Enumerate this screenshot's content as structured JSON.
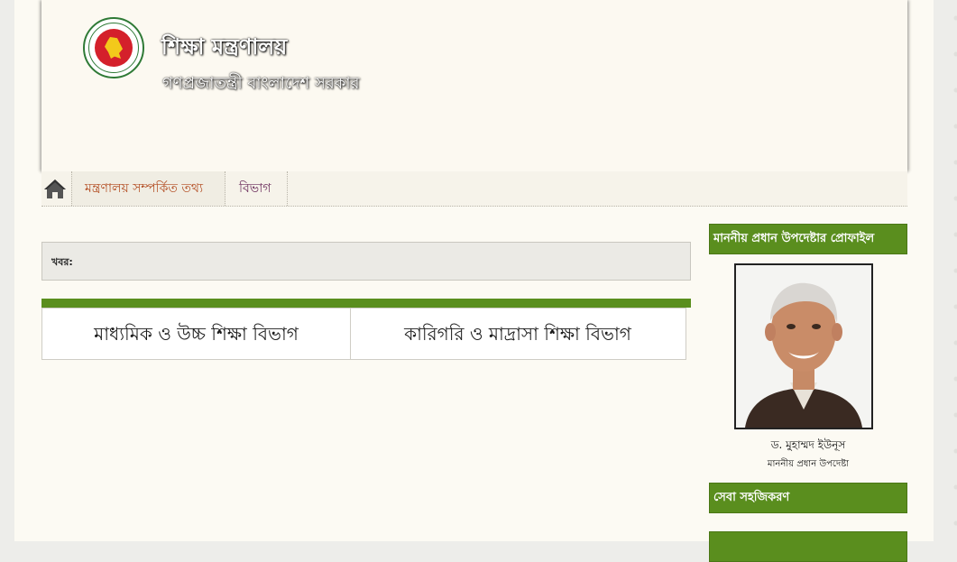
{
  "header": {
    "title": "শিক্ষা মন্ত্রণালয়",
    "subtitle": "গণপ্রজাতন্ত্রী বাংলাদেশ সরকার"
  },
  "nav": {
    "home_icon": "home-icon",
    "tabs": [
      {
        "label": "মন্ত্রণালয় সম্পর্কিত তথ্য",
        "active": true
      },
      {
        "label": "বিভাগ",
        "active": false
      }
    ]
  },
  "news": {
    "label": "খবর:"
  },
  "departments": [
    {
      "label": "মাধ্যমিক ও উচ্চ শিক্ষা বিভাগ"
    },
    {
      "label": "কারিগরি ও মাদ্রাসা শিক্ষা বিভাগ"
    }
  ],
  "sidebar": {
    "profile_heading": "মাননীয় প্রধান উপদেষ্টার প্রোফাইল",
    "profile_name": "ড. মুহাম্মদ ইউনূস",
    "profile_role": "মাননীয় প্রধান উপদেষ্টা",
    "service_heading": "সেবা সহজিকরণ"
  },
  "colors": {
    "accent_green": "#5a8e1e",
    "active_tab": "#b24a1f",
    "tab_text": "#6b2d5c",
    "logo_red": "#d4202b"
  }
}
